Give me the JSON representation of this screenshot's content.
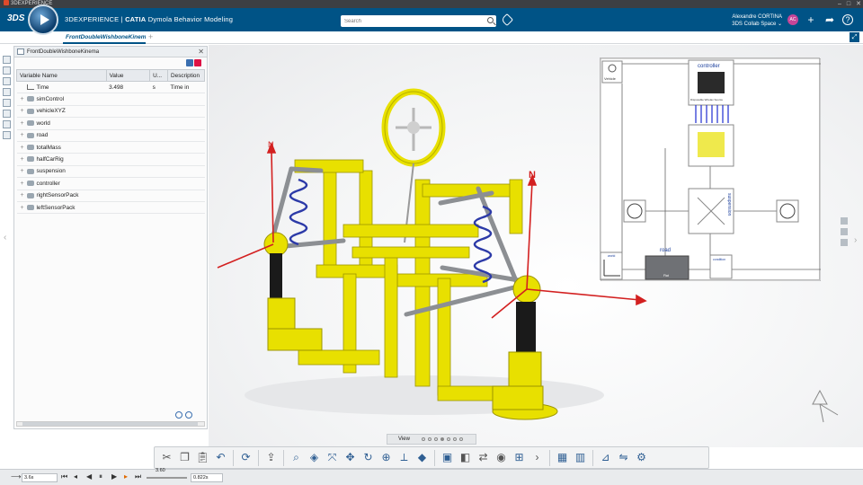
{
  "os": {
    "title": "3DEXPERIENCE"
  },
  "header": {
    "brand_product": "3DEXPERIENCE",
    "brand_sep": " | ",
    "brand_app_bold": "CATIA",
    "brand_app": " Dymola Behavior Modeling",
    "search_placeholder": "Search",
    "user_name": "Alexandre CORTINA",
    "user_space": "3DS Collab Space",
    "avatar_initials": "AC"
  },
  "tabs": [
    {
      "label": "FrontDoubleWishboneKinema"
    }
  ],
  "panel": {
    "title": "FrontDoubleWishboneKinema",
    "columns": [
      "Variable Name",
      "Value",
      "U...",
      "Description"
    ],
    "rows": [
      {
        "name": "Time",
        "value": "3.498",
        "unit": "s",
        "desc": "Time in",
        "icon": "time-icon"
      },
      {
        "name": "simControl",
        "value": "",
        "unit": "",
        "desc": "",
        "icon": "component-icon"
      },
      {
        "name": "vehicleXYZ",
        "value": "",
        "unit": "",
        "desc": "",
        "icon": "component-icon"
      },
      {
        "name": "world",
        "value": "",
        "unit": "",
        "desc": "",
        "icon": "component-icon"
      },
      {
        "name": "road",
        "value": "",
        "unit": "",
        "desc": "",
        "icon": "component-icon"
      },
      {
        "name": "totalMass",
        "value": "",
        "unit": "",
        "desc": "",
        "icon": "component-icon"
      },
      {
        "name": "halfCarRig",
        "value": "",
        "unit": "",
        "desc": "",
        "icon": "component-icon"
      },
      {
        "name": "suspension",
        "value": "",
        "unit": "",
        "desc": "",
        "icon": "component-icon"
      },
      {
        "name": "controller",
        "value": "",
        "unit": "",
        "desc": "",
        "icon": "component-icon"
      },
      {
        "name": "rightSensorPack",
        "value": "",
        "unit": "",
        "desc": "",
        "icon": "component-icon"
      },
      {
        "name": "leftSensorPack",
        "value": "",
        "unit": "",
        "desc": "",
        "icon": "component-icon"
      }
    ]
  },
  "diagram": {
    "vehicle_label": "Vehicle",
    "controller_label": "controller",
    "controller_sublabel": "Disposable Wirelax Source",
    "suspension_label": "suspension",
    "road_label": "road",
    "road_sub": "Flat",
    "world_label": "world",
    "condition_label": "condition"
  },
  "scene": {
    "axis_labels": [
      "N",
      "N"
    ]
  },
  "view": {
    "label": "View"
  },
  "playback": {
    "time_field": "3.6s",
    "slider_value": "3.60",
    "end_field": "0.822s"
  },
  "colors": {
    "header": "#005386",
    "accent": "#2f5f93",
    "yellow": "#e8e000"
  }
}
